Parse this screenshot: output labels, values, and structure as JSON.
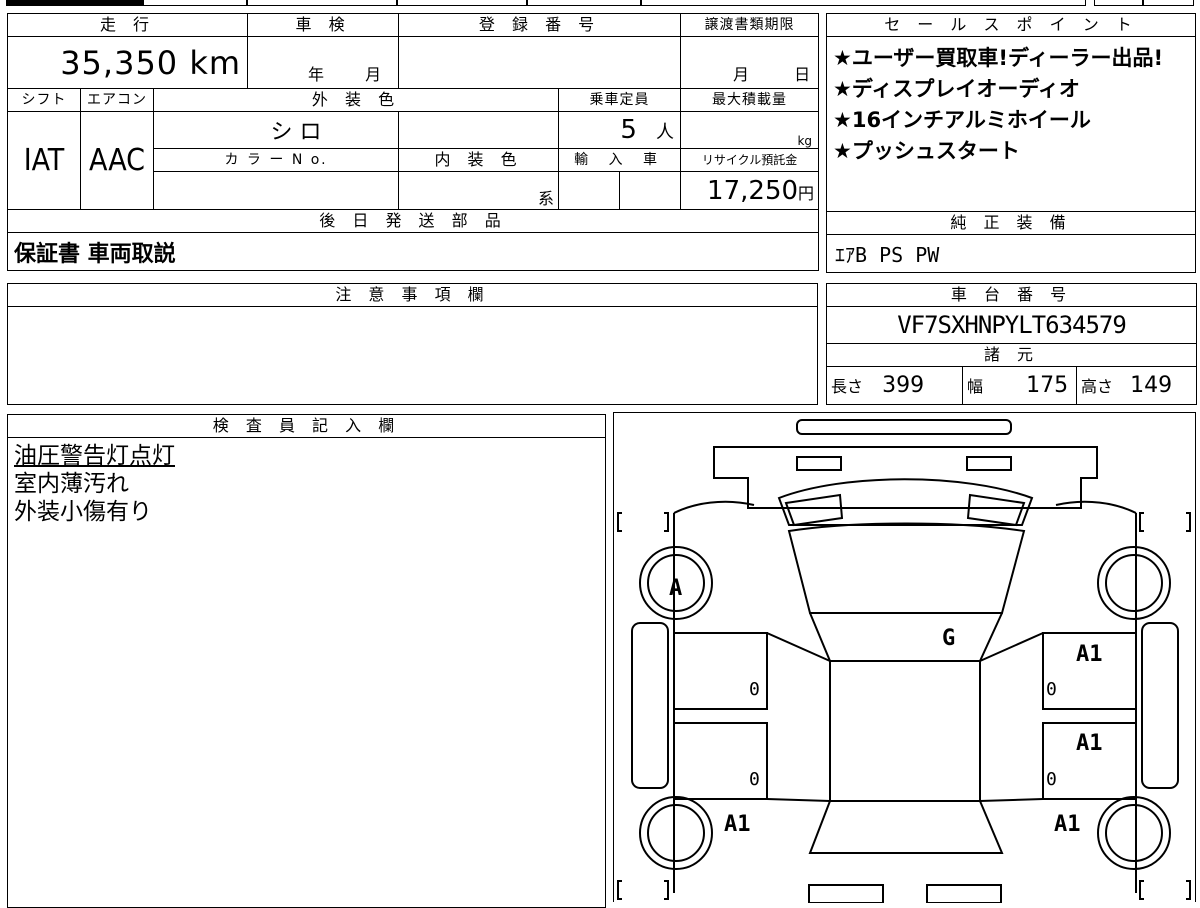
{
  "header": {
    "mileage_label": "走 行",
    "inspection_label": "車 検",
    "registration_label": "登 録 番 号",
    "transfer_deadline_label": "譲渡書類期限",
    "sales_points_label": "セ ー ル ス ポ イ ン ト"
  },
  "vehicle": {
    "mileage": "35,350 km",
    "inspection_year_unit": "年",
    "inspection_month_unit": "月",
    "transfer_month_unit": "月",
    "transfer_day_unit": "日",
    "shift_label": "シフト",
    "aircon_label": "エアコン",
    "exterior_color_label": "外 装 色",
    "capacity_label": "乗車定員",
    "max_load_label": "最大積載量",
    "shift": "IAT",
    "aircon": "AAC",
    "exterior_color": "シ ロ",
    "capacity": "5",
    "capacity_unit": "人",
    "max_load_unit": "kg",
    "color_no_label": "カ ラ ー N o.",
    "interior_color_label": "内 装 色",
    "import_label": "輸 入 車",
    "recycle_label": "リサイクル預託金",
    "interior_color_suffix": "系",
    "recycle_fee": "17,250",
    "recycle_unit": "円"
  },
  "sales_points": [
    "★ユーザー買取車!ディーラー出品!",
    "★ディスプレイオーディオ",
    "★16インチアルミホイール",
    "★プッシュスタート"
  ],
  "later_parts": {
    "label": "後 日 発 送 部 品",
    "value": "保証書 車両取説"
  },
  "genuine_equipment": {
    "label": "純 正 装 備",
    "value": "ｴｱB PS PW"
  },
  "notes": {
    "label": "注 意 事 項 欄",
    "value": ""
  },
  "chassis": {
    "label": "車 台 番 号",
    "value": "VF7SXHNPYLT634579"
  },
  "specs": {
    "label": "諸 元",
    "length_label": "長さ",
    "length": "399",
    "width_label": "幅",
    "width": "175",
    "height_label": "高さ",
    "height": "149"
  },
  "inspector": {
    "label": "検 査 員 記 入 欄",
    "lines": [
      "油圧警告灯点灯",
      "室内薄汚れ",
      "外装小傷有り"
    ]
  },
  "diagram": {
    "marks": {
      "front_left_wheel": "A",
      "windshield": "G",
      "right_front_door": "A1",
      "right_rear_door": "A1",
      "left_rear_fender": "A1",
      "right_rear_fender": "A1",
      "left_front_door_zero": "0",
      "left_rear_door_zero": "0",
      "right_front_door_zero": "0",
      "right_rear_door_zero": "0"
    }
  }
}
